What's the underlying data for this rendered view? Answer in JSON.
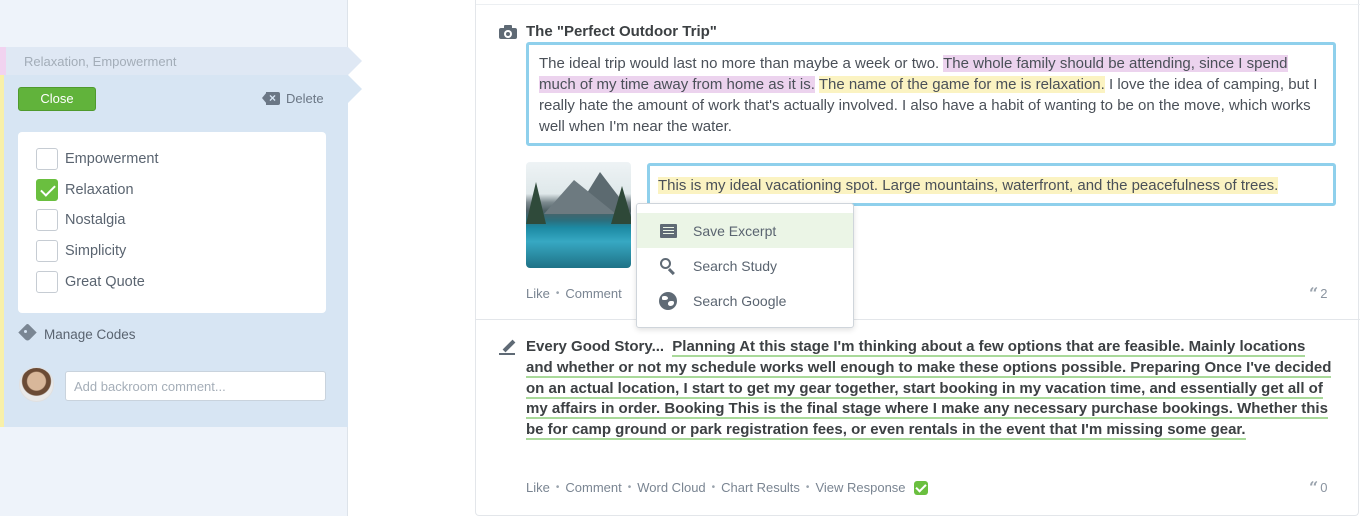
{
  "sidebar": {
    "selected_codes_label": "Relaxation, Empowerment",
    "close_label": "Close",
    "delete_label": "Delete",
    "codes": [
      {
        "label": "Empowerment",
        "checked": false
      },
      {
        "label": "Relaxation",
        "checked": true
      },
      {
        "label": "Nostalgia",
        "checked": false
      },
      {
        "label": "Simplicity",
        "checked": false
      },
      {
        "label": "Great Quote",
        "checked": false
      }
    ],
    "manage_codes_label": "Manage Codes",
    "comment_placeholder": "Add backroom comment..."
  },
  "post1": {
    "title": "The \"Perfect Outdoor Trip\"",
    "text_parts": [
      "The ideal trip would last no more than maybe a week or two. ",
      "The whole family should be attending, since I spend much of my time away from home as it is.",
      " ",
      "The name of the game for me is relaxation.",
      " I love the idea of camping, but I really hate the amount of work that's actually involved. I also have a habit of wanting to be on the move, which works well when I'm near the water."
    ],
    "image_caption": "This is my ideal vacationing spot. Large mountains, waterfront, and the peacefulness of trees.",
    "actions": [
      "Like",
      "Comment"
    ],
    "quote_count": "2"
  },
  "context_menu": {
    "items": [
      {
        "label": "Save Excerpt",
        "icon": "excerpt-icon"
      },
      {
        "label": "Search Study",
        "icon": "search-icon"
      },
      {
        "label": "Search Google",
        "icon": "globe-icon"
      }
    ]
  },
  "post2": {
    "title": "Every Good Story...",
    "body": "Planning At this stage I'm thinking about a few options that are feasible. Mainly locations and whether or not my schedule works well enough to make these options possible. Preparing Once I've decided on an actual location, I start to get my gear together, start booking in my vacation time, and essentially get all of my affairs in order. Booking This is the final stage where I make any necessary purchase bookings. Whether this be for camp ground or park registration fees, or even rentals in the event that I'm missing some gear.",
    "actions": [
      "Like",
      "Comment",
      "Word Cloud",
      "Chart Results",
      "View Response"
    ],
    "quote_count": "0"
  },
  "colors": {
    "accent_green": "#61b33b",
    "highlight_blue": "#8fd0ec",
    "highlight_purple": "#ecd3ee",
    "highlight_yellow": "#fbf3c2"
  }
}
